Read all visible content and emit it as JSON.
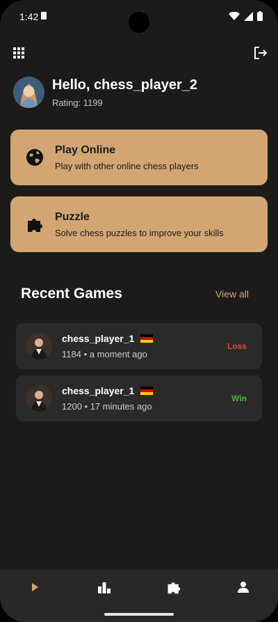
{
  "status_bar": {
    "time": "1:42"
  },
  "user": {
    "greeting": "Hello, chess_player_2",
    "rating": "Rating: 1199"
  },
  "cards": [
    {
      "title": "Play Online",
      "subtitle": "Play with other online chess players",
      "icon": "globe-icon"
    },
    {
      "title": "Puzzle",
      "subtitle": "Solve chess puzzles to improve your skills",
      "icon": "puzzle-icon"
    }
  ],
  "recent": {
    "title": "Recent Games",
    "view_all": "View all",
    "games": [
      {
        "player": "chess_player_1",
        "meta": "1184 • a moment ago",
        "result": "Loss",
        "result_color": "#e2483d"
      },
      {
        "player": "chess_player_1",
        "meta": "1200 • 17 minutes ago",
        "result": "Win",
        "result_color": "#4caf50"
      }
    ]
  },
  "colors": {
    "accent": "#d2a573",
    "background": "#1d1b1a",
    "card_dark": "#2c2a29"
  },
  "bottom_nav": [
    "play-icon",
    "leaderboard-icon",
    "puzzle-icon",
    "profile-icon"
  ]
}
